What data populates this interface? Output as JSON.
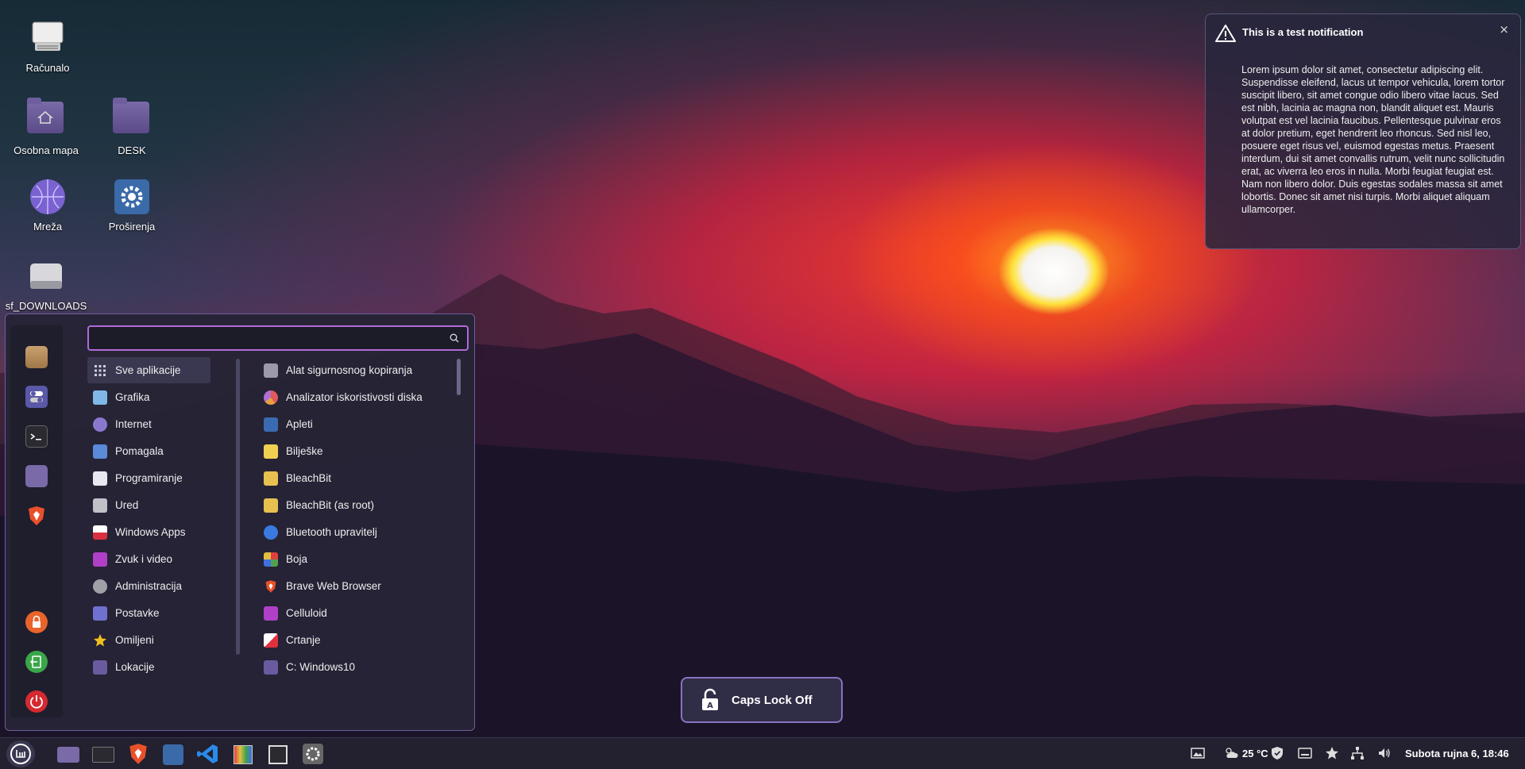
{
  "desktop": {
    "icons": [
      {
        "label": "Računalo",
        "icon": "computer-icon"
      },
      {
        "label": "Osobna mapa",
        "icon": "home-folder-icon"
      },
      {
        "label": "DESK",
        "icon": "folder-icon"
      },
      {
        "label": "Mreža",
        "icon": "network-icon"
      },
      {
        "label": "Proširenja",
        "icon": "settings-icon"
      },
      {
        "label": "sf_DOWNLOADS",
        "icon": "drive-icon"
      }
    ]
  },
  "notification": {
    "title": "This is a test notification",
    "close": "×",
    "body": "Lorem ipsum dolor sit amet, consectetur adipiscing elit. Suspendisse eleifend, lacus ut tempor vehicula, lorem tortor suscipit libero, sit amet congue odio libero vitae lacus. Sed est nibh, lacinia ac magna non, blandit aliquet est. Mauris volutpat est vel lacinia faucibus. Pellentesque pulvinar eros at dolor pretium, eget hendrerit leo rhoncus. Sed nisl leo, posuere eget risus vel, euismod egestas metus. Praesent interdum, dui sit amet convallis rutrum, velit nunc sollicitudin erat, ac viverra leo eros in nulla. Morbi feugiat feugiat est. Nam non libero dolor. Duis egestas sodales massa sit amet lobortis. Donec sit amet nisi turpis. Morbi aliquet aliquam ullamcorper."
  },
  "menu": {
    "search": {
      "value": "",
      "placeholder": ""
    },
    "categories": [
      {
        "label": "Sve aplikacije",
        "color": "#cfcfe0"
      },
      {
        "label": "Grafika",
        "color": "#7fb8e6"
      },
      {
        "label": "Internet",
        "color": "#8a78d0"
      },
      {
        "label": "Pomagala",
        "color": "#5a8ad8"
      },
      {
        "label": "Programiranje",
        "color": "#e8e8f0"
      },
      {
        "label": "Ured",
        "color": "#c0c0c8"
      },
      {
        "label": "Windows Apps",
        "color": "#d83040"
      },
      {
        "label": "Zvuk i video",
        "color": "#b040c8"
      },
      {
        "label": "Administracija",
        "color": "#a0a0a8"
      },
      {
        "label": "Postavke",
        "color": "#7070d0"
      },
      {
        "label": "Omiljeni",
        "color": "#f0c020"
      },
      {
        "label": "Lokacije",
        "color": "#6a5aa0"
      }
    ],
    "apps": [
      {
        "label": "Alat sigurnosnog kopiranja",
        "color": "#9a9aa8"
      },
      {
        "label": "Analizator iskoristivosti diska",
        "color": "#e05a5a"
      },
      {
        "label": "Apleti",
        "color": "#3a6ab0"
      },
      {
        "label": "Bilješke",
        "color": "#f0d050"
      },
      {
        "label": "BleachBit",
        "color": "#e8c050"
      },
      {
        "label": "BleachBit (as root)",
        "color": "#e8c050"
      },
      {
        "label": "Bluetooth upravitelj",
        "color": "#3a7ae0"
      },
      {
        "label": "Boja",
        "color": "#50a050"
      },
      {
        "label": "Brave Web Browser",
        "color": "#e8502a"
      },
      {
        "label": "Celluloid",
        "color": "#b040c8"
      },
      {
        "label": "Crtanje",
        "color": "#e03040"
      },
      {
        "label": "C: Windows10",
        "color": "#6a5aa0"
      }
    ],
    "favorites": [
      "package-icon",
      "toggle-settings-icon",
      "terminal-icon",
      "file-manager-icon",
      "brave-icon"
    ],
    "session": [
      "lock-screen-icon",
      "logout-icon",
      "power-icon"
    ]
  },
  "osd": {
    "label": "Caps Lock Off",
    "icon": "lock-open-icon"
  },
  "panel": {
    "launchers": [
      "menu-icon",
      "file-manager-icon",
      "terminal-icon",
      "brave-icon",
      "settings-icon",
      "vscode-icon",
      "color-app-icon",
      "screenshot-icon",
      "system-settings-icon"
    ],
    "temperature": "25 °C",
    "clock": "Subota rujna 6, 18:46"
  },
  "colors": {
    "accent": "#b06ad8",
    "panel": "#23202f",
    "menu_bg": "#26243a"
  }
}
